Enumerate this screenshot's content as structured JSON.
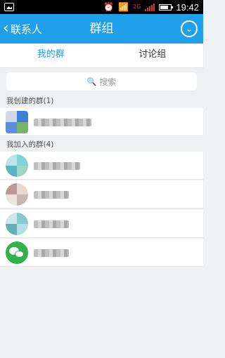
{
  "statusbar": {
    "alarm_icon": "alarm-clock-icon",
    "wifi_icon": "wifi-icon",
    "signal_label": "2G",
    "time": "19:42"
  },
  "navbar": {
    "back_label": "联系人",
    "title": "群组",
    "more_icon": "chevron-down-circle-icon"
  },
  "tabs": [
    {
      "label": "我的群",
      "active": true
    },
    {
      "label": "讨论组",
      "active": false
    }
  ],
  "search": {
    "placeholder": "搜索"
  },
  "sections": [
    {
      "header": "我创建的群(1)"
    },
    {
      "header": "我加入的群(4)"
    }
  ],
  "colors": {
    "accent": "#1fa0e8",
    "background": "#f0f1f3",
    "wechat_green": "#2fb34a"
  }
}
